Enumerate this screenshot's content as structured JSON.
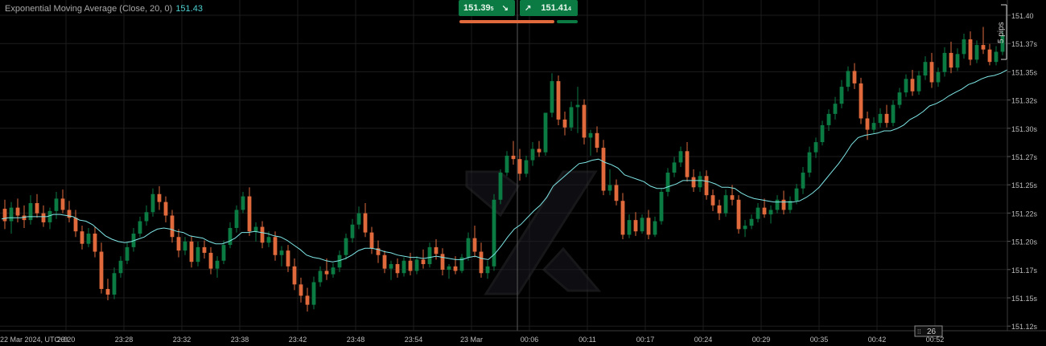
{
  "indicator": {
    "label": "Exponential Moving Average (Close, 20, 0)",
    "value": "151.43"
  },
  "trade": {
    "sell_price": "151.39",
    "sell_pip": "5",
    "buy_price": "151.41",
    "buy_pip": "4",
    "sell_icon": "arrow-down-right-icon",
    "buy_icon": "arrow-up-right-icon"
  },
  "pips_label": "5 pips",
  "bar_count": "26",
  "colors": {
    "up": "#0b7a43",
    "down": "#e06a3c",
    "ema": "#7fe6e6",
    "background": "#000000",
    "grid": "#1d1d1d"
  },
  "chart_data": {
    "type": "candlestick",
    "x_ticks": [
      "22 Mar 2024, UTC+9",
      "23:20",
      "23:28",
      "23:32",
      "23:38",
      "23:42",
      "23:48",
      "23:54",
      "23 Mar",
      "00:06",
      "00:11",
      "00:17",
      "00:24",
      "00:29",
      "00:35",
      "00:42",
      "00:52"
    ],
    "y_ticks": [
      "151.40",
      "151.37s",
      "151.35s",
      "151.32s",
      "151.30s",
      "151.27s",
      "151.25s",
      "151.22s",
      "151.20s",
      "151.17s",
      "151.15s",
      "151.12s"
    ],
    "ylim": [
      151.115,
      151.405
    ],
    "ohlc": [
      [
        151.223,
        151.231,
        151.205,
        151.212
      ],
      [
        151.212,
        151.229,
        151.201,
        151.224
      ],
      [
        151.224,
        151.232,
        151.211,
        151.217
      ],
      [
        151.217,
        151.226,
        151.206,
        151.213
      ],
      [
        151.213,
        151.235,
        151.209,
        151.228
      ],
      [
        151.228,
        151.236,
        151.215,
        151.219
      ],
      [
        151.219,
        151.226,
        151.207,
        151.211
      ],
      [
        151.211,
        151.224,
        151.205,
        151.221
      ],
      [
        151.221,
        151.238,
        151.214,
        151.232
      ],
      [
        151.232,
        151.24,
        151.219,
        151.222
      ],
      [
        151.222,
        151.23,
        151.211,
        151.215
      ],
      [
        151.215,
        151.222,
        151.198,
        151.203
      ],
      [
        151.203,
        151.208,
        151.187,
        151.192
      ],
      [
        151.192,
        151.206,
        151.189,
        151.201
      ],
      [
        151.201,
        151.207,
        151.18,
        151.185
      ],
      [
        151.185,
        151.193,
        151.148,
        151.152
      ],
      [
        151.152,
        151.161,
        151.142,
        151.147
      ],
      [
        151.147,
        151.171,
        151.143,
        151.166
      ],
      [
        151.166,
        151.181,
        151.162,
        151.177
      ],
      [
        151.177,
        151.193,
        151.174,
        151.189
      ],
      [
        151.189,
        151.206,
        151.185,
        151.201
      ],
      [
        151.201,
        151.216,
        151.198,
        151.212
      ],
      [
        151.212,
        151.226,
        151.208,
        151.22
      ],
      [
        151.22,
        151.241,
        151.216,
        151.236
      ],
      [
        151.236,
        151.243,
        151.222,
        151.229
      ],
      [
        151.229,
        151.234,
        151.211,
        151.217
      ],
      [
        151.217,
        151.222,
        151.193,
        151.198
      ],
      [
        151.198,
        151.205,
        151.18,
        151.186
      ],
      [
        151.186,
        151.198,
        151.182,
        151.194
      ],
      [
        151.194,
        151.199,
        151.171,
        151.176
      ],
      [
        151.176,
        151.194,
        151.172,
        151.189
      ],
      [
        151.189,
        151.195,
        151.179,
        151.184
      ],
      [
        151.184,
        151.189,
        151.165,
        151.17
      ],
      [
        151.17,
        151.181,
        151.162,
        151.177
      ],
      [
        151.177,
        151.195,
        151.174,
        151.191
      ],
      [
        151.191,
        151.211,
        151.188,
        151.206
      ],
      [
        151.206,
        151.226,
        151.202,
        151.222
      ],
      [
        151.222,
        151.238,
        151.219,
        151.234
      ],
      [
        151.234,
        151.242,
        151.199,
        151.203
      ],
      [
        151.203,
        151.211,
        151.194,
        151.207
      ],
      [
        151.207,
        151.212,
        151.188,
        151.193
      ],
      [
        151.193,
        151.203,
        151.189,
        151.198
      ],
      [
        151.198,
        151.203,
        151.177,
        151.182
      ],
      [
        151.182,
        151.19,
        151.172,
        151.186
      ],
      [
        151.186,
        151.191,
        151.167,
        151.172
      ],
      [
        151.172,
        151.179,
        151.151,
        151.156
      ],
      [
        151.156,
        151.162,
        151.14,
        151.146
      ],
      [
        151.146,
        151.153,
        151.132,
        151.138
      ],
      [
        151.138,
        151.163,
        151.134,
        151.158
      ],
      [
        151.158,
        151.172,
        151.154,
        151.168
      ],
      [
        151.168,
        151.179,
        151.16,
        151.165
      ],
      [
        151.165,
        151.175,
        151.162,
        151.171
      ],
      [
        151.171,
        151.186,
        151.167,
        151.182
      ],
      [
        151.182,
        151.201,
        151.178,
        151.197
      ],
      [
        151.197,
        151.214,
        151.193,
        151.209
      ],
      [
        151.209,
        151.225,
        151.205,
        151.219
      ],
      [
        151.219,
        151.228,
        151.198,
        151.202
      ],
      [
        151.202,
        151.207,
        151.183,
        151.188
      ],
      [
        151.188,
        151.195,
        151.175,
        151.182
      ],
      [
        151.182,
        151.186,
        151.166,
        151.17
      ],
      [
        151.17,
        151.177,
        151.16,
        151.174
      ],
      [
        151.174,
        151.179,
        151.162,
        151.166
      ],
      [
        151.166,
        151.18,
        151.163,
        151.177
      ],
      [
        151.177,
        151.184,
        151.164,
        151.168
      ],
      [
        151.168,
        151.181,
        151.165,
        151.178
      ],
      [
        151.178,
        151.187,
        151.17,
        151.174
      ],
      [
        151.174,
        151.193,
        151.171,
        151.189
      ],
      [
        151.189,
        151.196,
        151.178,
        151.183
      ],
      [
        151.183,
        151.188,
        151.164,
        151.169
      ],
      [
        151.169,
        151.174,
        151.161,
        151.172
      ],
      [
        151.172,
        151.181,
        151.165,
        151.168
      ],
      [
        151.168,
        151.183,
        151.166,
        151.18
      ],
      [
        151.18,
        151.202,
        151.177,
        151.197
      ],
      [
        151.197,
        151.208,
        151.18,
        151.185
      ],
      [
        151.185,
        151.193,
        151.162,
        151.166
      ],
      [
        151.166,
        151.177,
        151.161,
        151.172
      ],
      [
        151.172,
        151.236,
        151.168,
        151.231
      ],
      [
        151.231,
        151.258,
        151.227,
        151.255
      ],
      [
        151.255,
        151.274,
        151.252,
        151.27
      ],
      [
        151.27,
        151.283,
        151.262,
        151.267
      ],
      [
        151.267,
        151.276,
        151.248,
        151.254
      ],
      [
        151.254,
        151.27,
        151.251,
        151.266
      ],
      [
        151.266,
        151.282,
        151.261,
        151.276
      ],
      [
        151.276,
        151.283,
        151.269,
        151.273
      ],
      [
        151.273,
        151.296,
        151.27,
        151.308
      ],
      [
        151.308,
        151.343,
        151.304,
        151.336
      ],
      [
        151.336,
        151.341,
        151.297,
        151.302
      ],
      [
        151.302,
        151.309,
        151.288,
        151.295
      ],
      [
        151.295,
        151.318,
        151.292,
        151.313
      ],
      [
        151.313,
        151.331,
        151.29,
        151.315
      ],
      [
        151.315,
        151.32,
        151.28,
        151.286
      ],
      [
        151.286,
        151.293,
        151.27,
        151.29
      ],
      [
        151.29,
        151.296,
        151.273,
        151.277
      ],
      [
        151.277,
        151.284,
        151.235,
        151.239
      ],
      [
        151.239,
        151.258,
        151.235,
        151.244
      ],
      [
        151.244,
        151.249,
        151.226,
        151.23
      ],
      [
        151.23,
        151.237,
        151.196,
        151.2
      ],
      [
        151.2,
        151.218,
        151.197,
        151.213
      ],
      [
        151.213,
        151.22,
        151.199,
        151.203
      ],
      [
        151.203,
        151.218,
        151.201,
        151.215
      ],
      [
        151.215,
        151.222,
        151.196,
        151.2
      ],
      [
        151.2,
        151.216,
        151.198,
        151.212
      ],
      [
        151.212,
        151.241,
        151.209,
        151.238
      ],
      [
        151.238,
        151.259,
        151.234,
        151.255
      ],
      [
        151.255,
        151.269,
        151.251,
        151.264
      ],
      [
        151.264,
        151.278,
        151.26,
        151.274
      ],
      [
        151.274,
        151.282,
        151.247,
        151.251
      ],
      [
        151.251,
        151.258,
        151.238,
        151.242
      ],
      [
        151.242,
        151.256,
        151.238,
        151.252
      ],
      [
        151.252,
        151.257,
        151.231,
        151.235
      ],
      [
        151.235,
        151.24,
        151.221,
        151.226
      ],
      [
        151.226,
        151.231,
        151.213,
        151.219
      ],
      [
        151.219,
        151.24,
        151.216,
        151.235
      ],
      [
        151.235,
        151.244,
        151.226,
        151.231
      ],
      [
        151.231,
        151.235,
        151.201,
        151.205
      ],
      [
        151.205,
        151.213,
        151.198,
        151.208
      ],
      [
        151.208,
        151.218,
        151.205,
        151.214
      ],
      [
        151.214,
        151.228,
        151.211,
        151.224
      ],
      [
        151.224,
        151.232,
        151.215,
        151.218
      ],
      [
        151.218,
        151.226,
        151.21,
        151.222
      ],
      [
        151.222,
        151.235,
        151.219,
        151.231
      ],
      [
        151.231,
        151.239,
        151.218,
        151.222
      ],
      [
        151.222,
        151.234,
        151.219,
        151.23
      ],
      [
        151.23,
        151.245,
        151.227,
        151.241
      ],
      [
        151.241,
        151.26,
        151.236,
        151.255
      ],
      [
        151.255,
        151.278,
        151.251,
        151.273
      ],
      [
        151.273,
        151.286,
        151.268,
        151.282
      ],
      [
        151.282,
        151.301,
        151.279,
        151.297
      ],
      [
        151.297,
        151.311,
        151.292,
        151.307
      ],
      [
        151.307,
        151.322,
        151.302,
        151.316
      ],
      [
        151.316,
        151.337,
        151.312,
        151.331
      ],
      [
        151.331,
        151.349,
        151.327,
        151.345
      ],
      [
        151.345,
        151.352,
        151.329,
        151.334
      ],
      [
        151.334,
        151.339,
        151.298,
        151.303
      ],
      [
        151.303,
        151.309,
        151.284,
        151.293
      ],
      [
        151.293,
        151.304,
        151.29,
        151.299
      ],
      [
        151.299,
        151.312,
        151.295,
        151.307
      ],
      [
        151.307,
        151.315,
        151.295,
        151.299
      ],
      [
        151.299,
        151.319,
        151.296,
        151.315
      ],
      [
        151.315,
        151.33,
        151.312,
        151.326
      ],
      [
        151.326,
        151.342,
        151.322,
        151.338
      ],
      [
        151.338,
        151.346,
        151.323,
        151.327
      ],
      [
        151.327,
        151.345,
        151.324,
        151.341
      ],
      [
        151.341,
        151.358,
        151.337,
        151.353
      ],
      [
        151.353,
        151.361,
        151.33,
        151.335
      ],
      [
        151.335,
        151.348,
        151.331,
        151.344
      ],
      [
        151.344,
        151.366,
        151.34,
        151.361
      ],
      [
        151.361,
        151.371,
        151.343,
        151.348
      ],
      [
        151.348,
        151.365,
        151.345,
        151.36
      ],
      [
        151.36,
        151.378,
        151.356,
        151.373
      ],
      [
        151.373,
        151.38,
        151.35,
        151.355
      ],
      [
        151.355,
        151.372,
        151.352,
        151.368
      ],
      [
        151.368,
        151.384,
        151.36,
        151.364
      ],
      [
        151.364,
        151.369,
        151.35,
        151.353
      ],
      [
        151.353,
        151.367,
        151.35,
        151.362
      ],
      [
        151.362,
        151.38,
        151.359,
        151.376
      ],
      [
        151.376,
        151.394,
        151.372,
        151.389
      ]
    ],
    "ema": [
      151.214,
      151.215,
      151.215,
      151.215,
      151.216,
      151.216,
      151.216,
      151.216,
      151.218,
      151.218,
      151.217,
      151.216,
      151.213,
      151.212,
      151.209,
      151.204,
      151.199,
      151.196,
      151.194,
      151.193,
      151.194,
      151.196,
      151.198,
      151.202,
      151.205,
      151.206,
      151.205,
      151.203,
      151.202,
      151.199,
      151.198,
      151.197,
      151.194,
      151.192,
      151.192,
      151.194,
      151.197,
      151.202,
      151.202,
      151.203,
      151.202,
      151.201,
      151.199,
      151.198,
      151.195,
      151.191,
      151.187,
      151.182,
      151.18,
      151.179,
      151.177,
      151.176,
      151.177,
      151.179,
      151.182,
      151.186,
      151.188,
      151.188,
      151.187,
      151.185,
      151.184,
      151.182,
      151.181,
      151.18,
      151.18,
      151.179,
      151.18,
      151.181,
      151.18,
      151.179,
      151.178,
      151.178,
      151.18,
      151.181,
      151.179,
      151.178,
      151.183,
      151.19,
      151.198,
      151.205,
      151.209,
      151.215,
      151.221,
      151.226,
      151.233,
      151.243,
      151.248,
      151.253,
      151.258,
      151.263,
      151.264,
      151.266,
      151.267,
      151.264,
      151.262,
      151.259,
      151.253,
      151.251,
      151.249,
      151.247,
      151.243,
      151.241,
      151.241,
      151.243,
      151.245,
      151.248,
      151.248,
      151.248,
      151.248,
      151.247,
      151.245,
      151.242,
      151.242,
      151.241,
      151.237,
      151.234,
      151.232,
      151.231,
      151.23,
      151.229,
      151.229,
      151.229,
      151.229,
      151.23,
      151.233,
      151.237,
      151.242,
      151.249,
      151.256,
      151.263,
      151.271,
      151.28,
      151.286,
      151.288,
      151.289,
      151.29,
      151.292,
      151.292,
      151.294,
      151.297,
      151.302,
      151.305,
      151.309,
      151.314,
      151.316,
      151.319,
      151.323,
      151.326,
      151.329,
      151.333,
      151.335,
      151.338,
      151.34,
      151.341,
      151.343,
      151.346,
      151.35
    ]
  }
}
